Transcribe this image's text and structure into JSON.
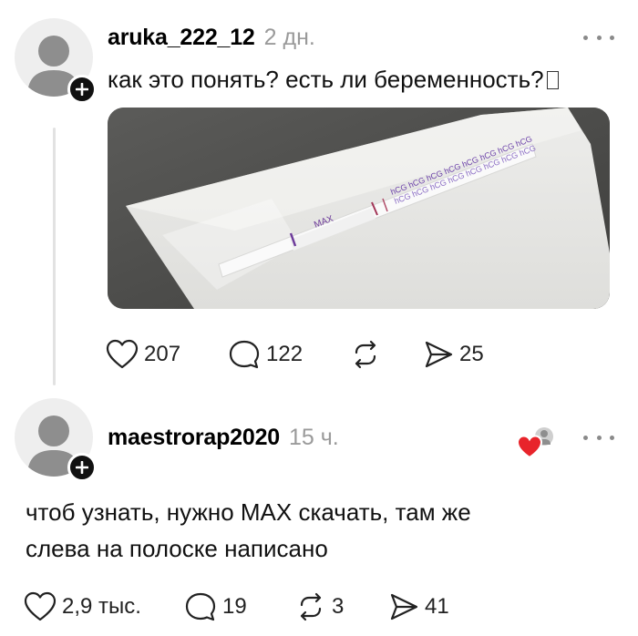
{
  "post": {
    "username": "aruka_222_12",
    "time": "2 дн.",
    "text": "как это понять? есть ли беременность?",
    "photo_texts": {
      "control_brand": "MAX",
      "strip_marks": "hCG hCG hCG hCG hCG hCG hCG hCG"
    },
    "actions": {
      "likes": "207",
      "comments": "122",
      "shares": "25"
    }
  },
  "comment": {
    "username": "maestrorap2020",
    "time": "15 ч.",
    "text": "чтоб узнать, нужно MAX скачать, там же слева на полоске написано",
    "actions": {
      "likes": "2,9 тыс.",
      "comments": "19",
      "reposts": "3",
      "shares": "41"
    }
  },
  "icons": {
    "like": "heart-icon",
    "comment": "comment-bubble-icon",
    "repost": "repost-icon",
    "share": "send-icon",
    "more": "more-dots-icon",
    "follow": "plus-icon"
  },
  "colors": {
    "reaction_heart": "#e8242b",
    "meta_gray": "#9a9a9a",
    "text": "#111111"
  }
}
